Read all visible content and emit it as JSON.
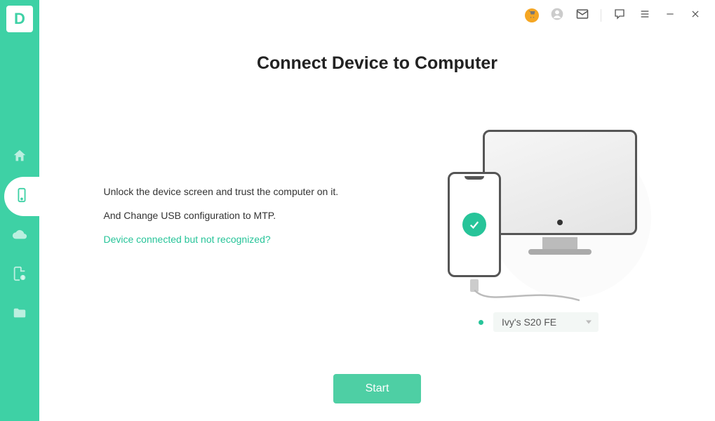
{
  "logo_letter": "D",
  "titlebar": {
    "icons": {
      "cart": "cart-icon",
      "account": "account-icon",
      "mail": "mail-icon",
      "feedback": "feedback-icon",
      "menu": "menu-icon",
      "minimize": "minimize-icon",
      "close": "close-icon"
    }
  },
  "sidebar": {
    "items": [
      {
        "name": "home",
        "icon": "home-icon"
      },
      {
        "name": "device",
        "icon": "phone-icon"
      },
      {
        "name": "cloud",
        "icon": "cloud-icon"
      },
      {
        "name": "file-alert",
        "icon": "file-alert-icon"
      },
      {
        "name": "folder",
        "icon": "folder-icon"
      }
    ],
    "active_index": 1
  },
  "page": {
    "title": "Connect Device to Computer",
    "instruction1": "Unlock the device screen and trust the computer on it.",
    "instruction2": "And Change USB configuration to MTP.",
    "help_link": "Device connected but not recognized?",
    "device_selected": "Ivy's S20 FE",
    "start_label": "Start"
  },
  "colors": {
    "accent": "#3ed1a5",
    "accent_dark": "#27c499",
    "warn": "#f5a623"
  }
}
